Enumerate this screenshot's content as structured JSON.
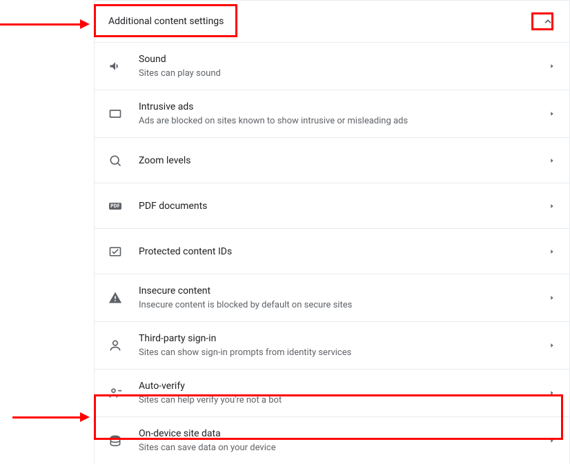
{
  "section": {
    "title": "Additional content settings"
  },
  "items": [
    {
      "icon": "sound-icon",
      "title": "Sound",
      "sub": "Sites can play sound"
    },
    {
      "icon": "intrusive-ads-icon",
      "title": "Intrusive ads",
      "sub": "Ads are blocked on sites known to show intrusive or misleading ads"
    },
    {
      "icon": "zoom-icon",
      "title": "Zoom levels",
      "sub": ""
    },
    {
      "icon": "pdf-icon",
      "title": "PDF documents",
      "sub": ""
    },
    {
      "icon": "protected-content-icon",
      "title": "Protected content IDs",
      "sub": ""
    },
    {
      "icon": "insecure-content-icon",
      "title": "Insecure content",
      "sub": "Insecure content is blocked by default on secure sites"
    },
    {
      "icon": "third-party-signin-icon",
      "title": "Third-party sign-in",
      "sub": "Sites can show sign-in prompts from identity services"
    },
    {
      "icon": "auto-verify-icon",
      "title": "Auto-verify",
      "sub": "Sites can help verify you're not a bot"
    },
    {
      "icon": "on-device-data-icon",
      "title": "On-device site data",
      "sub": "Sites can save data on your device"
    }
  ],
  "iconLabels": {
    "pdf": "PDF"
  }
}
